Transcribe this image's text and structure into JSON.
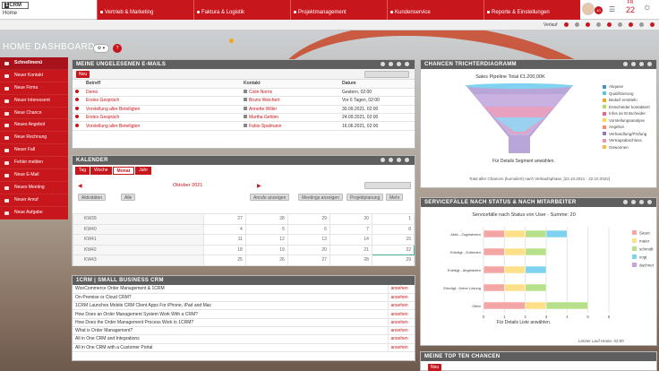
{
  "app": {
    "logo": "CRM",
    "logo_prefix": "1",
    "home": "Home"
  },
  "nav": [
    {
      "label": "Vertrieb & Marketing"
    },
    {
      "label": "Faktura & Logistik"
    },
    {
      "label": "Projektmanagement"
    },
    {
      "label": "Kundenservice"
    },
    {
      "label": "Reporte & Einstellungen"
    }
  ],
  "user": {
    "badge": "40"
  },
  "calendar_widget": {
    "day": "FR",
    "date": "22"
  },
  "subbar": {
    "verlauf": "Verlauf"
  },
  "dashboard": {
    "title": "HOME DASHBOARD"
  },
  "sidebar": [
    {
      "label": "Schnellmenü"
    },
    {
      "label": "Neuer Kontakt"
    },
    {
      "label": "Neue Firma"
    },
    {
      "label": "Neuer Interessent"
    },
    {
      "label": "Neue Chance"
    },
    {
      "label": "Neues Angebot"
    },
    {
      "label": "Neue Rechnung"
    },
    {
      "label": "Neuer Fall"
    },
    {
      "label": "Fehler melden"
    },
    {
      "label": "Neue E-Mail"
    },
    {
      "label": "Neues Meeting"
    },
    {
      "label": "Neuer Anruf"
    },
    {
      "label": "Neue Aufgabe"
    }
  ],
  "emails": {
    "title": "MEINE UNGELESENEN E-MAILS",
    "new_button": "Neu",
    "headers": [
      "Betreff",
      "Kontakt",
      "Datum"
    ],
    "rows": [
      {
        "subject": "Demo",
        "contact": "Colin Norris",
        "date": "Gestern, 02:00"
      },
      {
        "subject": "Erstes Gespräch",
        "contact": "Bruno Weichert",
        "date": "Vor 6 Tagen, 02:00"
      },
      {
        "subject": "Vorstellung aller Beteiligten",
        "contact": "Annette Willer",
        "date": "30.09.2021, 02:00"
      },
      {
        "subject": "Erstes Gespräch",
        "contact": "Martha Gehlen",
        "date": "24.09.2021, 02:00"
      },
      {
        "subject": "Vorstellung aller Beteiligten",
        "contact": "Fabio Spalmann",
        "date": "16.06.2021, 02:00"
      }
    ]
  },
  "kalender": {
    "title": "KALENDER",
    "tabs": [
      "Tag",
      "Woche",
      "Monat",
      "Jahr"
    ],
    "month": "Oktober 2021",
    "buttons": [
      "Anrufe anzeigen",
      "Meetings anzeigen",
      "Projektplanung",
      "Mehr"
    ],
    "filters": [
      "Aktivitäten",
      "Alle"
    ],
    "weeks": [
      {
        "kw": "KW39",
        "days": [
          "27",
          "28",
          "29",
          "30",
          "1"
        ]
      },
      {
        "kw": "KW40",
        "days": [
          "4",
          "5",
          "6",
          "7",
          "8"
        ]
      },
      {
        "kw": "KW41",
        "days": [
          "11",
          "12",
          "13",
          "14",
          "15"
        ]
      },
      {
        "kw": "KW42",
        "days": [
          "18",
          "19",
          "20",
          "21",
          "22"
        ]
      },
      {
        "kw": "KW43",
        "days": [
          "25",
          "26",
          "27",
          "28",
          "29"
        ]
      }
    ]
  },
  "news": {
    "title": "1CRM | SMALL BUSINESS CRM",
    "action": "ansehen",
    "items": [
      "WooCommerce Order Management & 1CRM",
      "On-Premise or Cloud CRM?",
      "1CRM Launches Mobile CRM Client Apps For iPhone, iPad and Mac",
      "How Does an Order Management System Work With a CRM?",
      "How Does the Order Management Process Work in 1CRM?",
      "What is Order Management?",
      "All in One CRM and Integrations",
      "All in One CRM with a Customer Portal"
    ]
  },
  "funnel": {
    "title": "CHANCEN TRICHTERDIAGRAMM",
    "chart_title": "Sales Pipeline Total €1.200,00K",
    "hint": "Für Details Segment anwählen.",
    "footer": "Total aller Chancen (kumuliert) nach Verkaufsphase, [22.10.2021 - 22.10.2022]",
    "legend": [
      {
        "label": "Akquise",
        "color": "#4a90d9"
      },
      {
        "label": "Qualifizierung",
        "color": "#59c6e8"
      },
      {
        "label": "Bedarf ermitteln",
        "color": "#f5a623"
      },
      {
        "label": "Entscheider kontaktiert",
        "color": "#b8d96b"
      },
      {
        "label": "Infos an Entscheider",
        "color": "#f06292"
      },
      {
        "label": "Vorstellungsanalyse",
        "color": "#ffd54f"
      },
      {
        "label": "Angebot",
        "color": "#ff8a65"
      },
      {
        "label": "Verhandlung/Prüfung",
        "color": "#9575cd"
      },
      {
        "label": "Vertragsabschluss",
        "color": "#f48fb1"
      },
      {
        "label": "Gewonnen",
        "color": "#ffb74d"
      }
    ]
  },
  "service": {
    "title": "SERVICEFÄLLE NACH STATUS & NACH MITARBEITER",
    "chart_title": "Servicefälle nach Status von User - Summe: 20",
    "hint": "Für Details Liste anwählen.",
    "footer": "Letzter Lauf Heute, 02:00"
  },
  "top": {
    "title": "MEINE TOP TEN CHANCEN",
    "new_button": "Neu"
  },
  "chart_data": {
    "type": "bar",
    "orientation": "horizontal-stacked",
    "title": "Servicefälle nach Status von User - Summe: 20",
    "categories": [
      "Aktiv - Zugewiesen",
      "Erledigt - Zufrieden",
      "Erledigt - Abgelaufen",
      "Erledigt - Keine Lösung",
      "Offen"
    ],
    "xlim": [
      0,
      6
    ],
    "xticks": [
      "0",
      "1",
      "2",
      "3",
      "4",
      "5",
      "6"
    ],
    "series": [
      {
        "name": "Sauer",
        "color": "#f4a6a6",
        "values": [
          1,
          1,
          1,
          1,
          2
        ]
      },
      {
        "name": "maier",
        "color": "#ffe08a",
        "values": [
          1,
          1,
          1,
          1,
          1
        ]
      },
      {
        "name": "schmidt",
        "color": "#b8e08a",
        "values": [
          1,
          1,
          0,
          1,
          2
        ]
      },
      {
        "name": "vogt",
        "color": "#7fd3f0",
        "values": [
          1,
          0,
          1,
          0,
          0
        ]
      },
      {
        "name": "dachner",
        "color": "#c9a3e0",
        "values": [
          0,
          0,
          0,
          0,
          0
        ]
      }
    ]
  }
}
